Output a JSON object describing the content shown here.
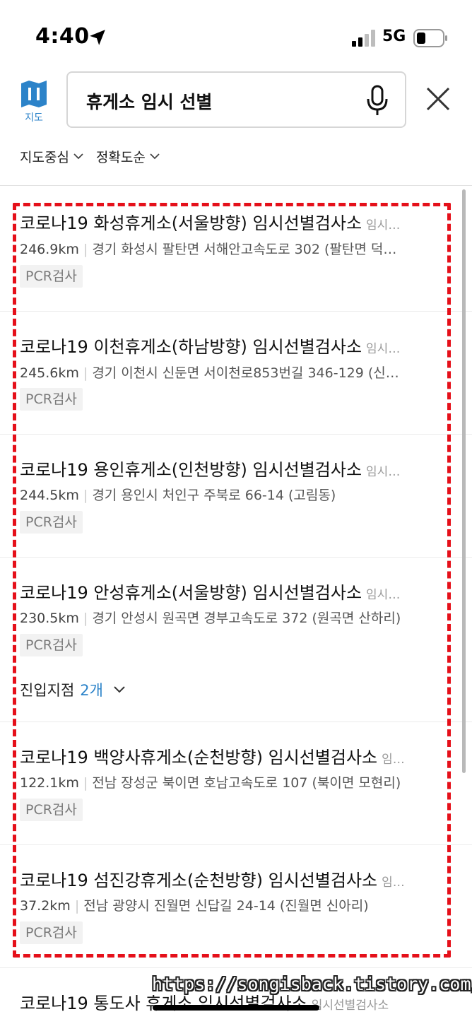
{
  "status_bar": {
    "time": "4:40",
    "network": "5G",
    "icons": [
      "location-arrow-icon",
      "signal-icon",
      "battery-icon"
    ]
  },
  "header": {
    "map_label": "지도",
    "search_value": "휴게소 임시 선별",
    "icons": [
      "map-icon",
      "mic-icon",
      "close-icon"
    ]
  },
  "filters": [
    {
      "label": "지도중심"
    },
    {
      "label": "정확도순"
    }
  ],
  "results": [
    {
      "title": "코로나19 화성휴게소(서울방향) 임시선별검사소",
      "category": "임시…",
      "distance": "246.9km",
      "address": "경기 화성시 팔탄면 서해안고속도로 302 (팔탄면 덕…",
      "tag": "PCR검사"
    },
    {
      "title": "코로나19 이천휴게소(하남방향) 임시선별검사소",
      "category": "임시…",
      "distance": "245.6km",
      "address": "경기 이천시 신둔면 서이천로853번길 346-129 (신…",
      "tag": "PCR검사"
    },
    {
      "title": "코로나19 용인휴게소(인천방향) 임시선별검사소",
      "category": "임시…",
      "distance": "244.5km",
      "address": "경기 용인시 처인구 주북로 66-14 (고림동)",
      "tag": "PCR검사"
    },
    {
      "title": "코로나19 안성휴게소(서울방향) 임시선별검사소",
      "category": "임시…",
      "distance": "230.5km",
      "address": "경기 안성시 원곡면 경부고속도로 372 (원곡면 산하리)",
      "tag": "PCR검사",
      "entry_label": "진입지점",
      "entry_count": "2개"
    },
    {
      "title": "코로나19 백양사휴게소(순천방향) 임시선별검사소",
      "category": "임…",
      "distance": "122.1km",
      "address": "전남 장성군 북이면 호남고속도로 107 (북이면 모현리)",
      "tag": "PCR검사"
    },
    {
      "title": "코로나19 섬진강휴게소(순천방향) 임시선별검사소",
      "category": "임…",
      "distance": "37.2km",
      "address": "전남 광양시 진월면 신답길 24-14 (진월면 신아리)",
      "tag": "PCR검사"
    },
    {
      "title": "코로나19 통도사 휴게소 임시선별검사소",
      "category": "임시선별검사소"
    }
  ],
  "watermark": "https://songisback.tistory.com/",
  "colors": {
    "accent": "#2c83c9",
    "highlight_border": "#e5101a"
  }
}
